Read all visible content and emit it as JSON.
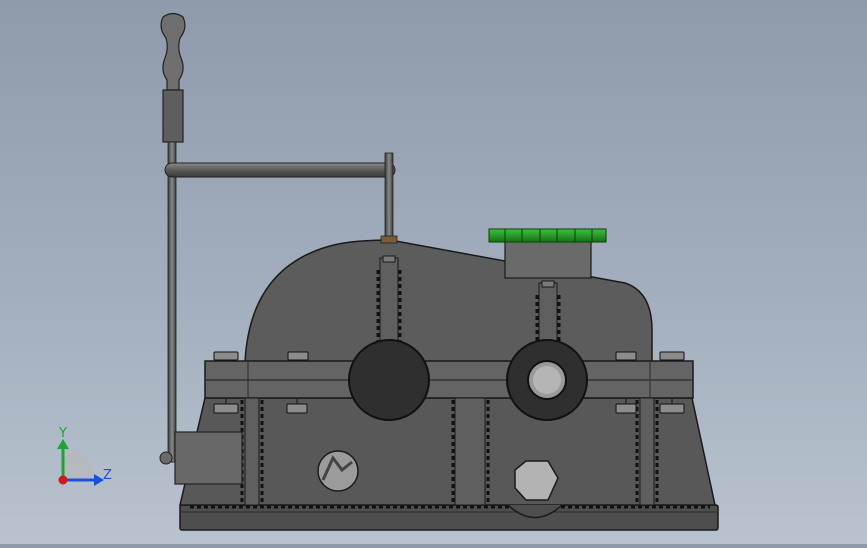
{
  "viewport": {
    "background_top": "#8f9bab",
    "background_bottom": "#b9c3cf"
  },
  "model": {
    "part_color": "#5b5b5b",
    "part_dark": "#343434",
    "edge_color": "#1a1a1a",
    "cap_color": "#1f8a1f",
    "highlight_color": "#a8a8a8"
  },
  "triad": {
    "y_label": "Y",
    "z_label": "Z",
    "y_color": "#1fa23a",
    "z_color": "#1f4fd8",
    "x_color": "#d01818"
  }
}
